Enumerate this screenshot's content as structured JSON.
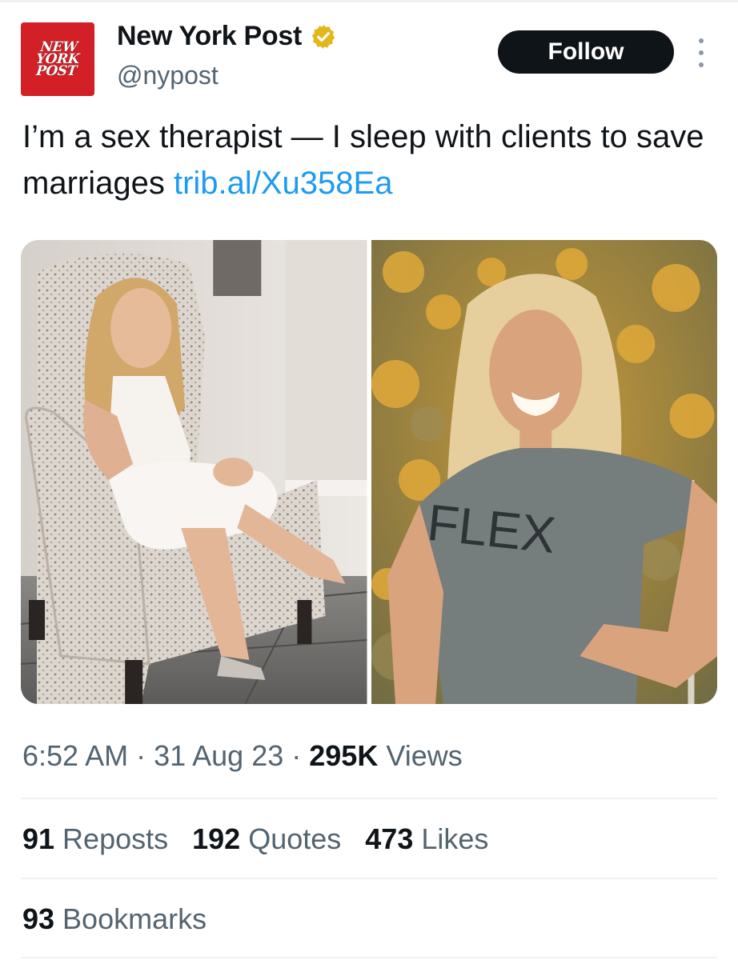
{
  "account": {
    "avatar_logo_lines": [
      "NEW",
      "YORK",
      "POST"
    ],
    "display_name": "New York Post",
    "handle": "@nypost",
    "verified_icon": "verified-badge-gold-icon",
    "follow_label": "Follow",
    "more_icon": "more-vertical-icon"
  },
  "tweet": {
    "text": "I’m a sex therapist — I sleep with clients to save marriages ",
    "link": "trib.al/Xu358Ea",
    "shirt_text": "FLEX"
  },
  "meta": {
    "time": "6:52 AM",
    "sep1": " · ",
    "date": "31 Aug 23",
    "sep2": " · ",
    "views_count": "295K",
    "views_label": " Views"
  },
  "stats": {
    "reposts_count": "91",
    "reposts_label": " Reposts",
    "quotes_count": "192",
    "quotes_label": " Quotes",
    "likes_count": "473",
    "likes_label": " Likes",
    "bookmarks_count": "93",
    "bookmarks_label": " Bookmarks"
  },
  "colors": {
    "brand_red": "#d31f26",
    "link_blue": "#1d9bf0",
    "verified_gold": "#e2b719",
    "muted_text": "#536471"
  }
}
